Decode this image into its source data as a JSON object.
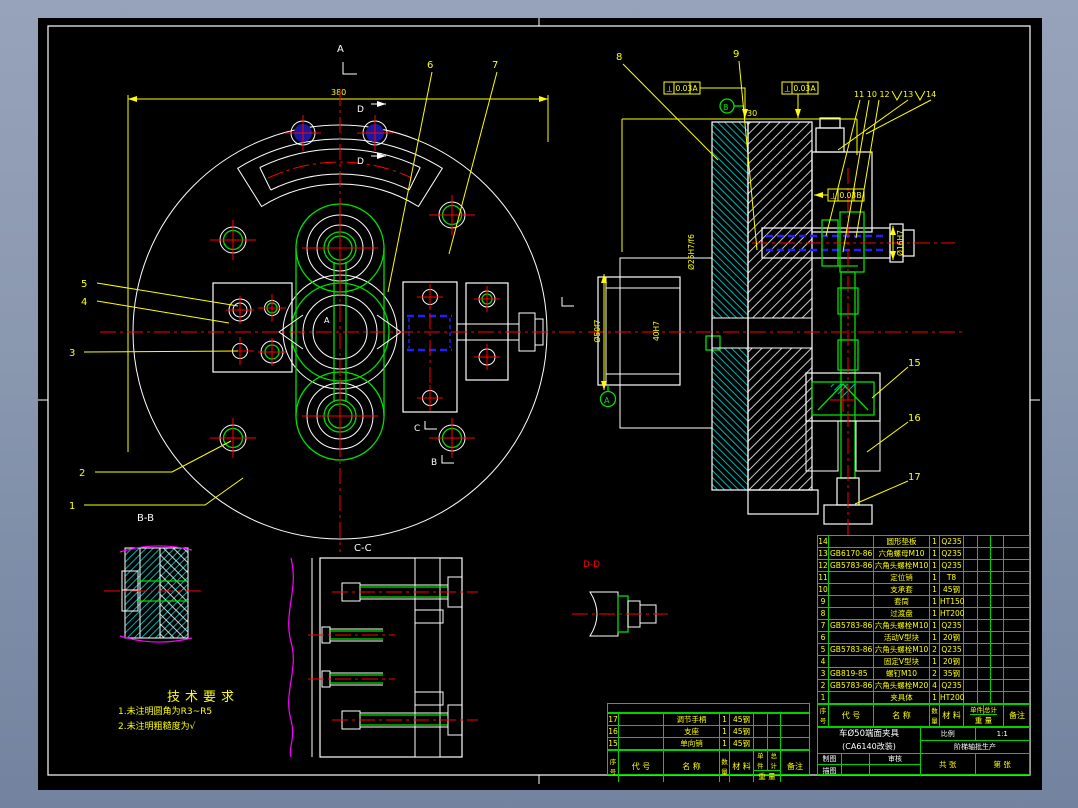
{
  "drawing": {
    "tech_req": {
      "title": "技术要求",
      "l1": "1.未注明圆角为R3~R5",
      "l2": "2.未注明粗糙度为√"
    },
    "front": {
      "dim380": "380",
      "secA": "A",
      "secD1": "D",
      "secD2": "D",
      "secC": "C",
      "secB": "B",
      "bb": "B-B",
      "cc": "C-C",
      "centerA": "A"
    },
    "right": {
      "dim30": "30",
      "dimBore": "Ø25H7/f6",
      "dimInner": "40H7",
      "dimCyl": "Ø50f7",
      "dimRod": "Ø16H7",
      "datumA": "A",
      "datumB": "B",
      "dd": "D-D",
      "tol": {
        "sym": "⊥",
        "val": "0.03",
        "refA": "A",
        "refB": "B"
      },
      "callouts_top": "11 10 12",
      "c13": "13",
      "c14": "14"
    },
    "callouts": {
      "c1": "1",
      "c2": "2",
      "c3": "3",
      "c4": "4",
      "c5": "5",
      "c6": "6",
      "c7": "7",
      "c8": "8",
      "c9": "9",
      "c15": "15",
      "c16": "16",
      "c17": "17"
    }
  },
  "parts_main": {
    "rows": [
      {
        "no": "14",
        "code": "",
        "name": "圆形垫板",
        "qty": "1",
        "mat": "Q235"
      },
      {
        "no": "13",
        "code": "GB6170-86",
        "name": "六角螺母M10",
        "qty": "1",
        "mat": "Q235"
      },
      {
        "no": "12",
        "code": "GB5783-86",
        "name": "六角头螺栓M10",
        "qty": "1",
        "mat": "Q235"
      },
      {
        "no": "11",
        "code": "",
        "name": "定位销",
        "qty": "1",
        "mat": "T8"
      },
      {
        "no": "10",
        "code": "",
        "name": "支承套",
        "qty": "1",
        "mat": "45钢"
      },
      {
        "no": "9",
        "code": "",
        "name": "套筒",
        "qty": "1",
        "mat": "HT150"
      },
      {
        "no": "8",
        "code": "",
        "name": "过渡盘",
        "qty": "1",
        "mat": "HT200"
      },
      {
        "no": "7",
        "code": "GB5783-86",
        "name": "六角头螺栓M10",
        "qty": "1",
        "mat": "Q235"
      },
      {
        "no": "6",
        "code": "",
        "name": "活动V型块",
        "qty": "1",
        "mat": "20钢"
      },
      {
        "no": "5",
        "code": "GB5783-86",
        "name": "六角头螺栓M10",
        "qty": "2",
        "mat": "Q235"
      },
      {
        "no": "4",
        "code": "",
        "name": "固定V型块",
        "qty": "1",
        "mat": "20钢"
      },
      {
        "no": "3",
        "code": "GB819-85",
        "name": "螺钉M10",
        "qty": "2",
        "mat": "35钢"
      },
      {
        "no": "2",
        "code": "GB5783-86",
        "name": "六角头螺栓M20",
        "qty": "4",
        "mat": "Q235"
      },
      {
        "no": "1",
        "code": "",
        "name": "夹具体",
        "qty": "1",
        "mat": "HT200"
      }
    ]
  },
  "parts_ext": {
    "rows": [
      {
        "no": "17",
        "code": "",
        "name": "调节手柄",
        "qty": "1",
        "mat": "45钢"
      },
      {
        "no": "16",
        "code": "",
        "name": "支座",
        "qty": "1",
        "mat": "45钢"
      },
      {
        "no": "15",
        "code": "",
        "name": "单向销",
        "qty": "1",
        "mat": "45钢"
      }
    ]
  },
  "table_header": {
    "no": "序号",
    "code": "代  号",
    "name": "名  称",
    "qty": "数量",
    "mat": "材 料",
    "unit": "单件",
    "total": "总计",
    "weight": "重 量",
    "note": "备注"
  },
  "title_block": {
    "title1": "车Ø50端面夹具",
    "title2": "(CA6140改装)",
    "scale_label": "比例",
    "scale_value": "1:1",
    "batch": "阶梯轴批生产",
    "sheet_total": "共  张",
    "sheet_no": "第  张",
    "draw": "制图",
    "trace": "描图",
    "check": "审核"
  }
}
